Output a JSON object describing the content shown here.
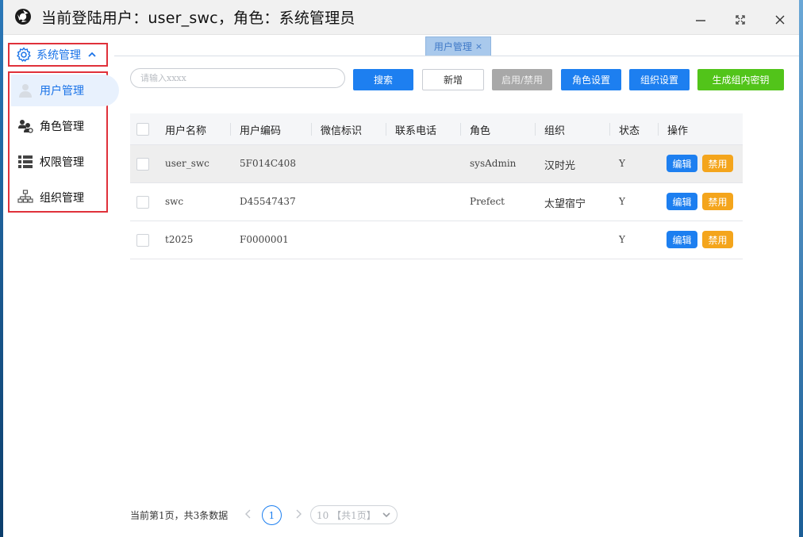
{
  "window": {
    "title": "当前登陆用户：user_swc，角色：系统管理员"
  },
  "sidebar": {
    "group_label": "系统管理",
    "items": [
      {
        "label": "用户管理",
        "icon": "user-icon",
        "active": true
      },
      {
        "label": "角色管理",
        "icon": "role-group-icon",
        "active": false
      },
      {
        "label": "权限管理",
        "icon": "list-icon",
        "active": false
      },
      {
        "label": "组织管理",
        "icon": "org-tree-icon",
        "active": false
      }
    ]
  },
  "tabs": [
    {
      "label": "用户管理",
      "close": "×"
    }
  ],
  "toolbar": {
    "search_placeholder": "请输入xxxx",
    "search_label": "搜索",
    "add_label": "新增",
    "toggle_label": "启用/禁用",
    "role_label": "角色设置",
    "org_label": "组织设置",
    "key_label": "生成组内密钥"
  },
  "table": {
    "columns": [
      "用户名称",
      "用户编码",
      "微信标识",
      "联系电话",
      "角色",
      "组织",
      "状态",
      "操作"
    ],
    "rows": [
      {
        "name": "user_swc",
        "code": "5F014C408",
        "wechat": "",
        "phone": "",
        "role": "sysAdmin",
        "org": "汉时光",
        "status": "Y"
      },
      {
        "name": "swc",
        "code": "D45547437",
        "wechat": "",
        "phone": "",
        "role": "Prefect",
        "org": "太望宿宁",
        "status": "Y"
      },
      {
        "name": "t2025",
        "code": "F0000001",
        "wechat": "",
        "phone": "",
        "role": "",
        "org": "",
        "status": "Y"
      }
    ],
    "edit_label": "编辑",
    "ban_label": "禁用"
  },
  "pagination": {
    "info": "当前第1页，共3条数据",
    "current_page": "1",
    "page_size": "10 【共1页】"
  },
  "colors": {
    "primary": "#1d7ff0",
    "warning": "#f4a51c",
    "success": "#52c41a",
    "highlight_box": "#e0313a"
  }
}
